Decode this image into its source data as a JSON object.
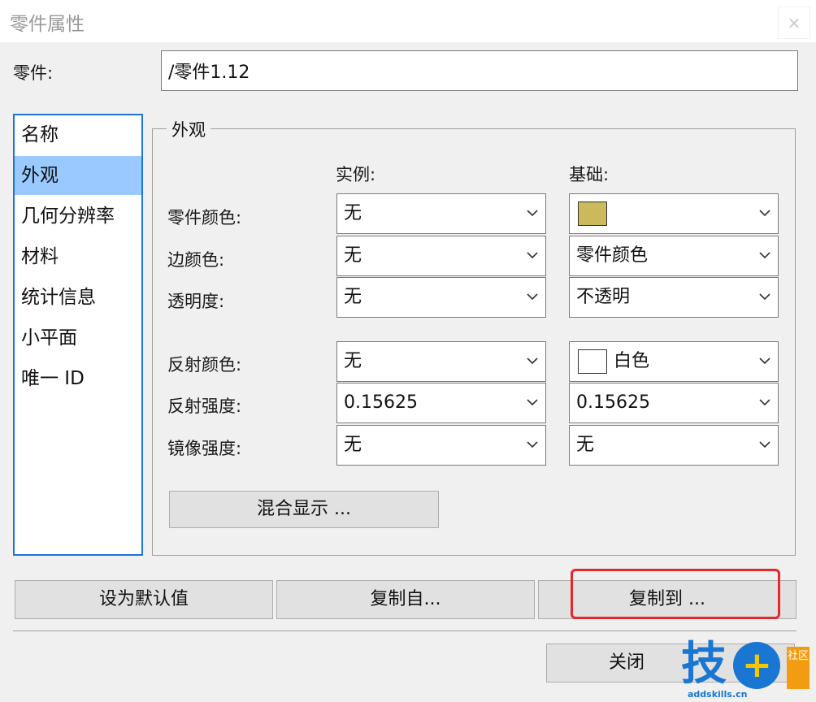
{
  "window": {
    "title": "零件属性",
    "close_glyph": "×"
  },
  "part": {
    "label": "零件:",
    "value": "/零件1.12"
  },
  "nav": {
    "items": [
      {
        "label": "名称"
      },
      {
        "label": "外观",
        "selected": true
      },
      {
        "label": "几何分辨率"
      },
      {
        "label": "材料"
      },
      {
        "label": "统计信息"
      },
      {
        "label": "小平面"
      },
      {
        "label": "唯一 ID"
      }
    ]
  },
  "appearance": {
    "group_title": "外观",
    "col_instance": "实例:",
    "col_base": "基础:",
    "rows": [
      {
        "label": "零件颜色:",
        "instance": "无",
        "base": "",
        "base_swatch": "#cbb95e"
      },
      {
        "label": "边颜色:",
        "instance": "无",
        "base": "零件颜色"
      },
      {
        "label": "透明度:",
        "instance": "无",
        "base": "不透明"
      },
      {
        "label": "反射颜色:",
        "instance": "无",
        "base": "白色",
        "base_swatch": "#ffffff"
      },
      {
        "label": "反射强度:",
        "instance": "0.15625",
        "base": "0.15625"
      },
      {
        "label": "镜像强度:",
        "instance": "无",
        "base": "无"
      }
    ],
    "blend_button": "混合显示 ..."
  },
  "actions": {
    "set_default": "设为默认值",
    "copy_from": "复制自...",
    "copy_to": "复制到 ...",
    "close": "关闭"
  },
  "watermark": {
    "char": "技",
    "plus": "+",
    "badge": "社区",
    "url": "addskills.cn"
  },
  "colors": {
    "selection": "#99c9ff",
    "list_border": "#1e74d6",
    "highlight": "#e8272a",
    "brand": "#1976d2"
  }
}
